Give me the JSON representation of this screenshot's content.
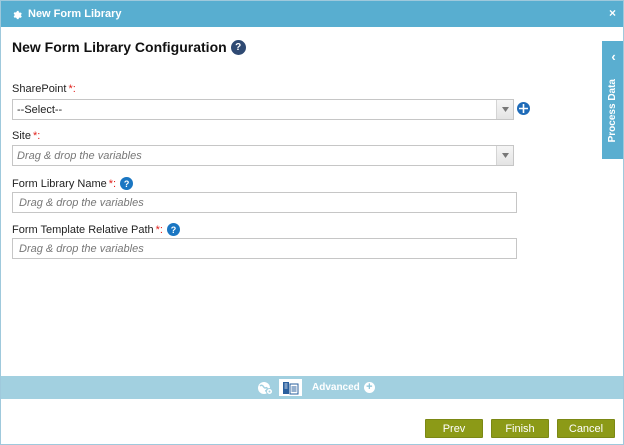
{
  "window": {
    "title": "New Form Library",
    "close_glyph": "×"
  },
  "heading": {
    "title": "New Form Library Configuration",
    "help_glyph": "?"
  },
  "fields": {
    "sharepoint": {
      "label": "SharePoint",
      "required_mark": "*:",
      "value": "--Select--"
    },
    "site": {
      "label": "Site",
      "required_mark": "*:",
      "placeholder": "Drag & drop the variables"
    },
    "form_library_name": {
      "label": "Form Library Name",
      "required_mark": "*:",
      "placeholder": "Drag & drop the variables"
    },
    "form_template_path": {
      "label": "Form Template Relative Path",
      "required_mark": "*:",
      "placeholder": "Drag & drop the variables"
    }
  },
  "side_panel": {
    "label": "Process Data",
    "chevron": "‹"
  },
  "bottom_strip": {
    "advanced_label": "Advanced",
    "plus_glyph": "+"
  },
  "buttons": {
    "prev": "Prev",
    "finish": "Finish",
    "cancel": "Cancel"
  },
  "icons": {
    "title": "gear-icon",
    "add": "plus-circle-icon",
    "tab1": "globe-gear-icon",
    "tab2": "document-list-icon"
  },
  "colors": {
    "titlebar": "#58aed0",
    "strip": "#a2d0e0",
    "button": "#8c9a17",
    "required": "#e0201b",
    "help": "#1a76c2"
  }
}
